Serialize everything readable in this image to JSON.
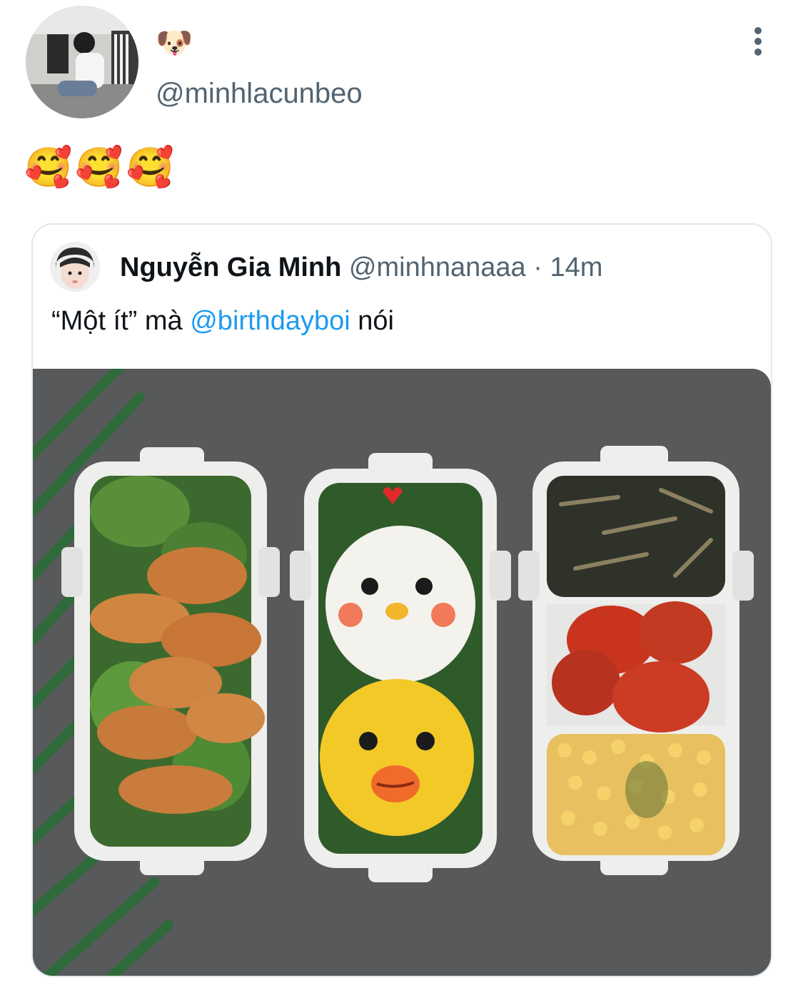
{
  "author": {
    "display_name": "🐶",
    "handle": "@minhlacunbeo"
  },
  "tweet": {
    "text": "🥰🥰🥰"
  },
  "quoted_tweet": {
    "name": "Nguyễn Gia Minh",
    "handle": "@minhnanaaa",
    "separator": "·",
    "time": "14m",
    "text_before": "“Một ít” mà ",
    "mention": "@birthdayboi",
    "text_after": " nói"
  },
  "icons": {
    "more": "more-vertical-icon"
  },
  "colors": {
    "link": "#1d9bf0",
    "secondary_text": "#536471",
    "border": "#e1e8ed"
  }
}
